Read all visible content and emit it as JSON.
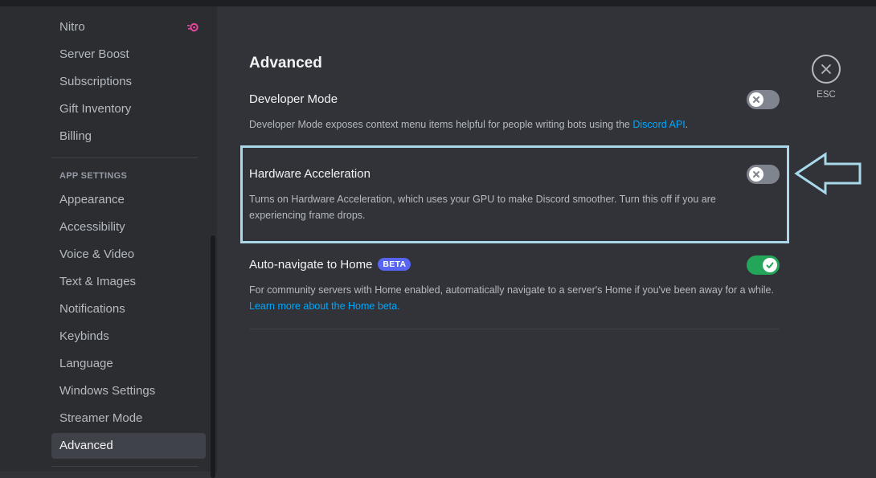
{
  "sidebar": {
    "items_top": [
      {
        "label": "Nitro"
      },
      {
        "label": "Server Boost"
      },
      {
        "label": "Subscriptions"
      },
      {
        "label": "Gift Inventory"
      },
      {
        "label": "Billing"
      }
    ],
    "app_settings_header": "APP SETTINGS",
    "items_app": [
      {
        "label": "Appearance"
      },
      {
        "label": "Accessibility"
      },
      {
        "label": "Voice & Video"
      },
      {
        "label": "Text & Images"
      },
      {
        "label": "Notifications"
      },
      {
        "label": "Keybinds"
      },
      {
        "label": "Language"
      },
      {
        "label": "Windows Settings"
      },
      {
        "label": "Streamer Mode"
      },
      {
        "label": "Advanced",
        "selected": true
      }
    ]
  },
  "main": {
    "title": "Advanced",
    "options": [
      {
        "title": "Developer Mode",
        "desc": "Developer Mode exposes context menu items helpful for people writing bots using the ",
        "link": "Discord API",
        "desc_end": ".",
        "enabled": false
      },
      {
        "title": "Hardware Acceleration",
        "desc": "Turns on Hardware Acceleration, which uses your GPU to make Discord smoother. Turn this off if you are experiencing frame drops.",
        "enabled": false
      },
      {
        "title": "Auto-navigate to Home",
        "badge": "BETA",
        "desc": "For community servers with Home enabled, automatically navigate to a server's Home if you've been away for a while. ",
        "link": "Learn more about the Home beta.",
        "enabled": true
      }
    ]
  },
  "close": {
    "label": "ESC",
    "icon": "close-icon"
  },
  "annotation": {
    "icon": "left-arrow-icon",
    "color": "#a8d8ea"
  },
  "colors": {
    "toggle_on": "#23a55a",
    "toggle_off": "#80848e",
    "link": "#00a8fc",
    "badge": "#5865f2",
    "nitro": "#eb459e"
  }
}
